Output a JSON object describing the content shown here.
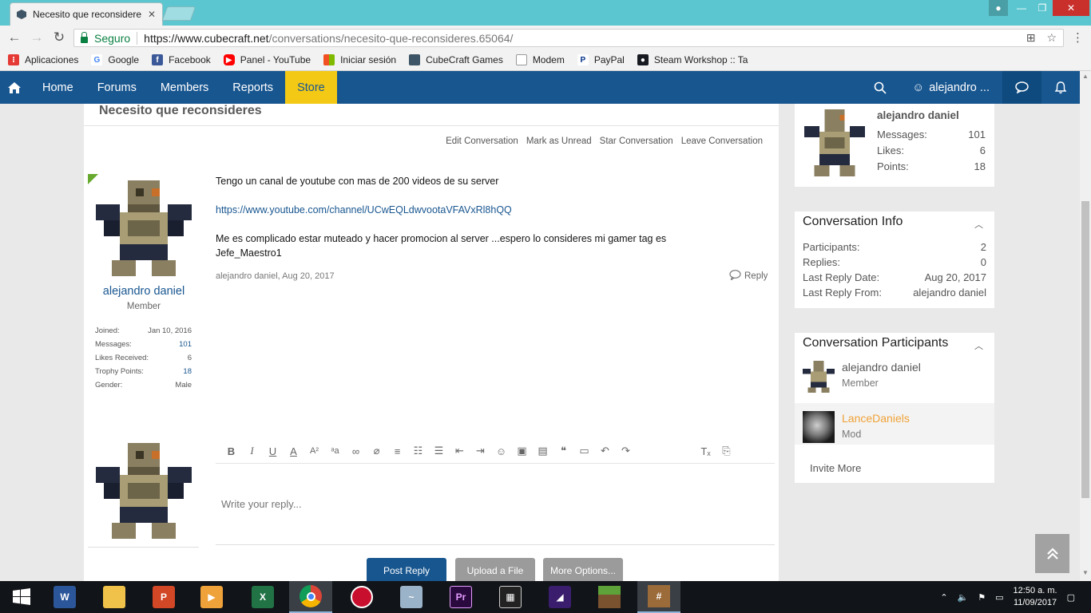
{
  "browser": {
    "tab_title": "Necesito que reconsidere",
    "secure_label": "Seguro",
    "url_host": "https://www.cubecraft.net",
    "url_path": "/conversations/necesito-que-reconsideres.65064/",
    "bookmarks": [
      {
        "label": "Aplicaciones",
        "icon": "apps-grid-icon",
        "color": "#e53935"
      },
      {
        "label": "Google",
        "icon": "google-icon",
        "color": "#4285f4"
      },
      {
        "label": "Facebook",
        "icon": "facebook-icon",
        "color": "#3b5998"
      },
      {
        "label": "Panel - YouTube",
        "icon": "youtube-icon",
        "color": "#ff0000"
      },
      {
        "label": "Iniciar sesión",
        "icon": "microsoft-icon",
        "color": "#f25022"
      },
      {
        "label": "CubeCraft Games",
        "icon": "cubecraft-icon",
        "color": "#3d5566"
      },
      {
        "label": "Modem",
        "icon": "page-icon",
        "color": "#999999"
      },
      {
        "label": "PayPal",
        "icon": "paypal-icon",
        "color": "#003087"
      },
      {
        "label": "Steam Workshop :: Ta",
        "icon": "steam-icon",
        "color": "#171a21"
      }
    ]
  },
  "forum_nav": {
    "items": [
      "Home",
      "Forums",
      "Members",
      "Reports",
      "Store"
    ],
    "username": "alejandro ..."
  },
  "conversation": {
    "title": "Necesito que reconsideres",
    "actions": [
      "Edit Conversation",
      "Mark as Unread",
      "Star Conversation",
      "Leave Conversation"
    ]
  },
  "post": {
    "author": "alejandro daniel",
    "author_title": "Member",
    "stats": [
      {
        "label": "Joined:",
        "value": "Jan 10, 2016"
      },
      {
        "label": "Messages:",
        "value": "101"
      },
      {
        "label": "Likes Received:",
        "value": "6"
      },
      {
        "label": "Trophy Points:",
        "value": "18"
      },
      {
        "label": "Gender:",
        "value": "Male"
      }
    ],
    "paragraph_1": "Tengo un canal de youtube con mas de 200 videos de su server",
    "link": "https://www.youtube.com/channel/UCwEQLdwvootaVFAVxRl8hQQ",
    "paragraph_3": "Me es complicado estar muteado y hacer promocion al server ...espero lo consideres mi gamer tag es Jefe_Maestro1",
    "meta_author": "alejandro daniel",
    "meta_date": ", Aug 20, 2017",
    "reply_label": "Reply"
  },
  "reply": {
    "placeholder": "Write your reply...",
    "post_button": "Post Reply",
    "upload_button": "Upload a File",
    "more_button": "More Options..."
  },
  "sidebar": {
    "user": {
      "name": "alejandro daniel",
      "stats": [
        {
          "label": "Messages:",
          "value": "101"
        },
        {
          "label": "Likes:",
          "value": "6"
        },
        {
          "label": "Points:",
          "value": "18"
        }
      ]
    },
    "info": {
      "title": "Conversation Info",
      "rows": [
        {
          "label": "Participants:",
          "value": "2"
        },
        {
          "label": "Replies:",
          "value": "0"
        },
        {
          "label": "Last Reply Date:",
          "value": "Aug 20, 2017"
        },
        {
          "label": "Last Reply From:",
          "value": "alejandro daniel"
        }
      ]
    },
    "participants": {
      "title": "Conversation Participants",
      "list": [
        {
          "name": "alejandro daniel",
          "role": "Member"
        },
        {
          "name": "LanceDaniels",
          "role": "Mod"
        }
      ],
      "invite": "Invite More"
    }
  },
  "taskbar": {
    "time": "12:50 a. m.",
    "date": "11/09/2017"
  },
  "colors": {
    "brand": "#185690",
    "store": "#f3c915",
    "mod_name": "#f0a236",
    "title_bar": "#5bc6cf"
  }
}
